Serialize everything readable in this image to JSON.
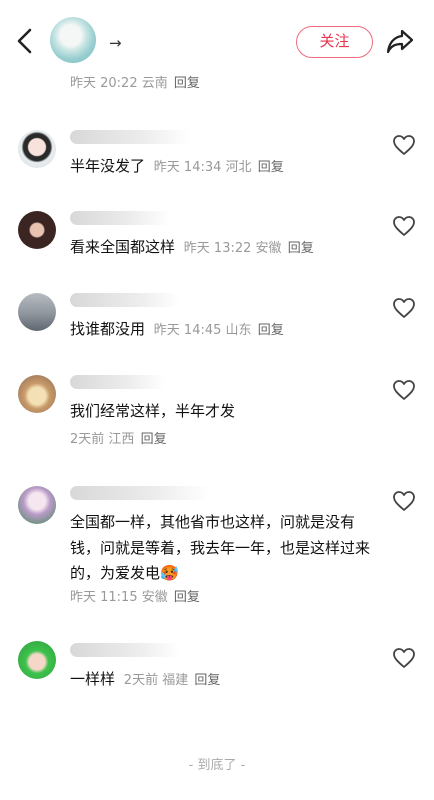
{
  "header": {
    "name": "→",
    "follow_label": "关注"
  },
  "previous_comment": {
    "time": "昨天 20:22",
    "location": "云南",
    "reply_label": "回复"
  },
  "comments": [
    {
      "text": "半年没发了",
      "time": "昨天 14:34",
      "location": "河北",
      "reply_label": "回复"
    },
    {
      "text": "看来全国都这样",
      "time": "昨天 13:22",
      "location": "安徽",
      "reply_label": "回复"
    },
    {
      "text": "找谁都没用",
      "time": "昨天 14:45",
      "location": "山东",
      "reply_label": "回复"
    },
    {
      "text": "我们经常这样，半年才发",
      "time": "2天前",
      "location": "江西",
      "reply_label": "回复"
    },
    {
      "text": "全国都一样，其他省市也这样，问就是没有钱，问就是等着，我去年一年，也是这样过来的，为爱发电🥵",
      "time": "昨天 11:15",
      "location": "安徽",
      "reply_label": "回复"
    },
    {
      "text": "一样样",
      "time": "2天前",
      "location": "福建",
      "reply_label": "回复"
    }
  ],
  "footer": {
    "end_label": "- 到底了 -"
  },
  "icons": {
    "back": "chevron-left-icon",
    "share": "share-arrow-icon",
    "like": "heart-outline-icon"
  },
  "colors": {
    "accent": "#e8364f"
  }
}
